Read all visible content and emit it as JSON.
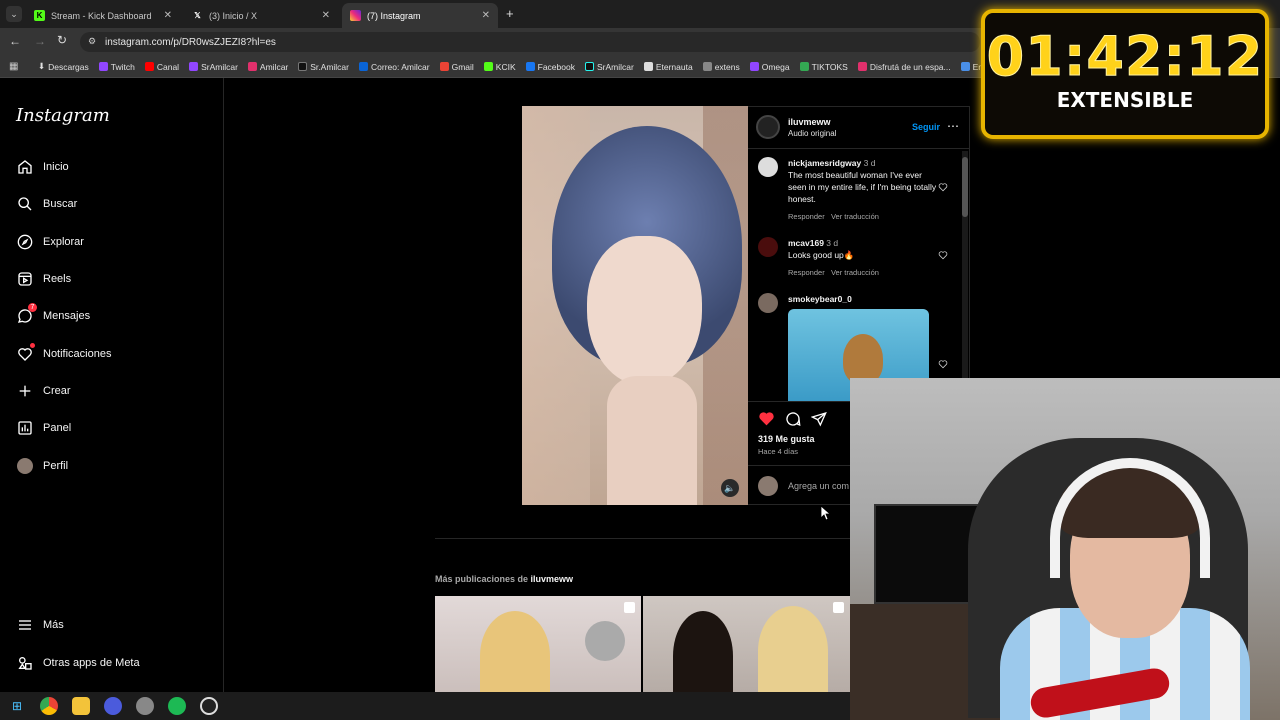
{
  "browser": {
    "tabs": [
      {
        "title": "Stream - Kick Dashboard",
        "icon": "kick-icon"
      },
      {
        "title": "(3) Inicio / X",
        "icon": "x-icon"
      },
      {
        "title": "(7) Instagram",
        "icon": "instagram-icon"
      }
    ],
    "url": "instagram.com/p/DR0wsZJEZI8?hl=es",
    "bookmarks": [
      "Descargas",
      "Twitch",
      "Canal",
      "SrAmilcar",
      "Amilcar",
      "Sr.Amilcar",
      "Correo: Amilcar",
      "Gmail",
      "KCIK",
      "Facebook",
      "SrAmilcar",
      "Eternauta",
      "extens",
      "Omega",
      "TIKTOKS",
      "Disfrutá de un espa...",
      "Emu"
    ]
  },
  "instagram": {
    "logo": "Instagram",
    "nav": [
      {
        "label": "Inicio",
        "icon": "home-icon"
      },
      {
        "label": "Buscar",
        "icon": "search-icon"
      },
      {
        "label": "Explorar",
        "icon": "compass-icon"
      },
      {
        "label": "Reels",
        "icon": "reels-icon"
      },
      {
        "label": "Mensajes",
        "icon": "messenger-icon",
        "badge": "7"
      },
      {
        "label": "Notificaciones",
        "icon": "heart-icon"
      },
      {
        "label": "Crear",
        "icon": "plus-icon"
      },
      {
        "label": "Panel",
        "icon": "chart-icon"
      },
      {
        "label": "Perfil",
        "icon": "avatar-icon"
      }
    ],
    "more": "Más",
    "meta_apps": "Otras apps de Meta",
    "post": {
      "username": "iluvmeww",
      "audio": "Audio original",
      "follow": "Seguir",
      "comments": [
        {
          "user": "nickjamesridgway",
          "time": "3 d",
          "text": "The most beautiful woman I've ever seen in my entire life, if I'm being totally honest.",
          "reply": "Responder",
          "translate": "Ver traducción"
        },
        {
          "user": "mcav169",
          "time": "3 d",
          "text": "Looks good up🔥",
          "reply": "Responder",
          "translate": "Ver traducción"
        },
        {
          "user": "smokeybear0_0",
          "time": "",
          "text": ""
        }
      ],
      "likes": "319 Me gusta",
      "posted": "Hace 4 días",
      "add_comment_placeholder": "Agrega un com"
    },
    "more_posts_prefix": "Más publicaciones de",
    "more_posts_user": "iluvmeww"
  },
  "overlay": {
    "timer": "01:42:12",
    "subtitle": "EXTENSIBLE"
  },
  "colors": {
    "accent": "#0095f6",
    "like": "#ff3040",
    "timer_border": "#e7b400"
  }
}
